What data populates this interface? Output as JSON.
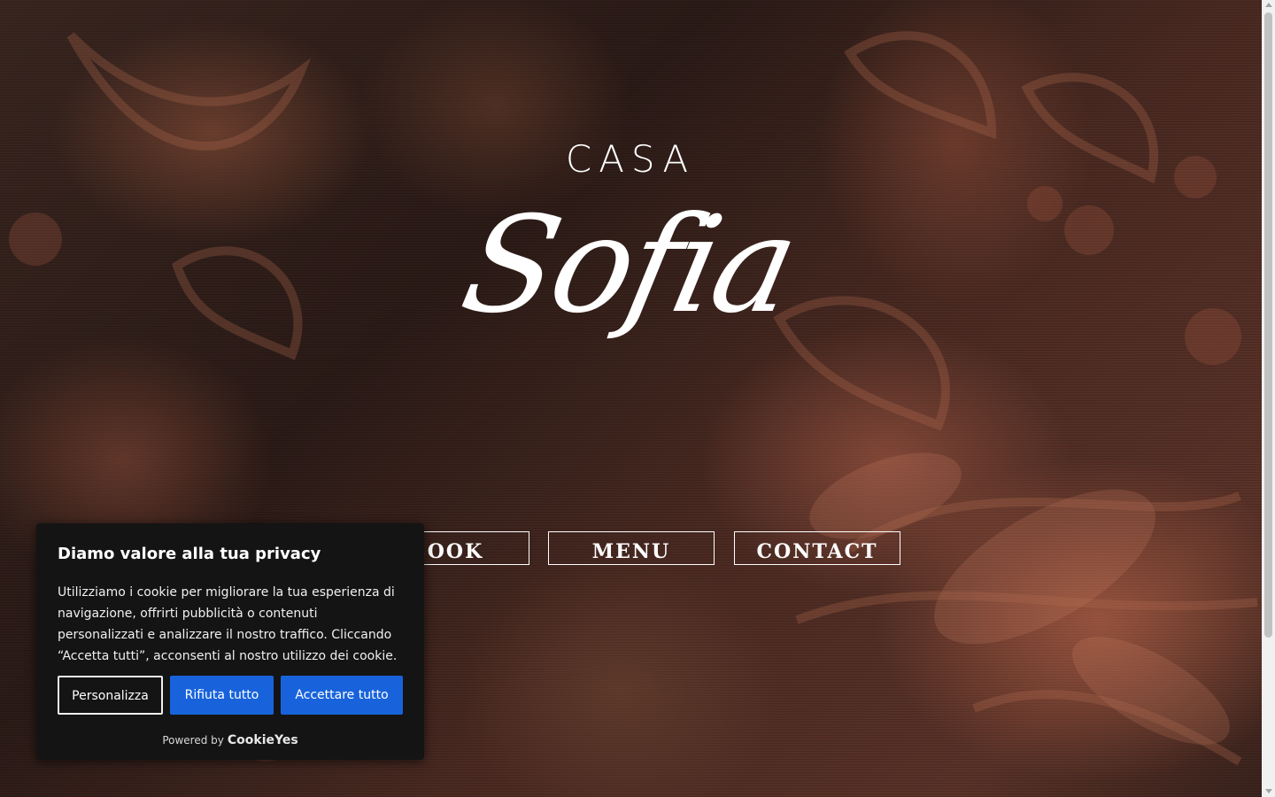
{
  "logo": {
    "line1": "CASA",
    "line2": "Sofia"
  },
  "nav": [
    {
      "label": "BOOK"
    },
    {
      "label": "MENU"
    },
    {
      "label": "CONTACT"
    }
  ],
  "cookie_banner": {
    "title": "Diamo valore alla tua privacy",
    "text": "Utilizziamo i cookie per migliorare la tua esperienza di navigazione, offrirti pubblicità o contenuti personalizzati e analizzare il nostro traffico. Cliccando “Accetta tutti”, acconsenti al nostro utilizzo dei cookie.",
    "customize_label": "Personalizza",
    "reject_label": "Rifiuta tutto",
    "accept_label": "Accettare tutto",
    "powered_label": "Powered by",
    "brand": "CookieYes"
  },
  "colors": {
    "banner_bg": "#141414",
    "button_blue": "#1863dc",
    "text_white": "#ffffff"
  }
}
